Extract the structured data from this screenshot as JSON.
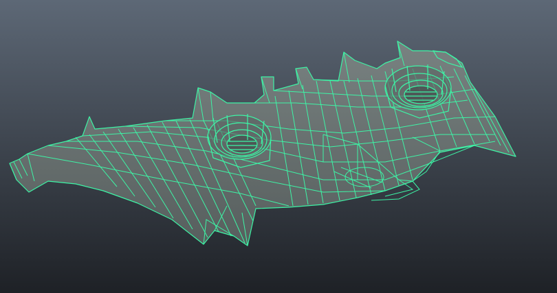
{
  "viewport": {
    "background_top": "#5d6876",
    "background_bottom": "#1e2126",
    "wireframe_color": "#3df5a6",
    "mesh_fill": "#7b8481"
  }
}
